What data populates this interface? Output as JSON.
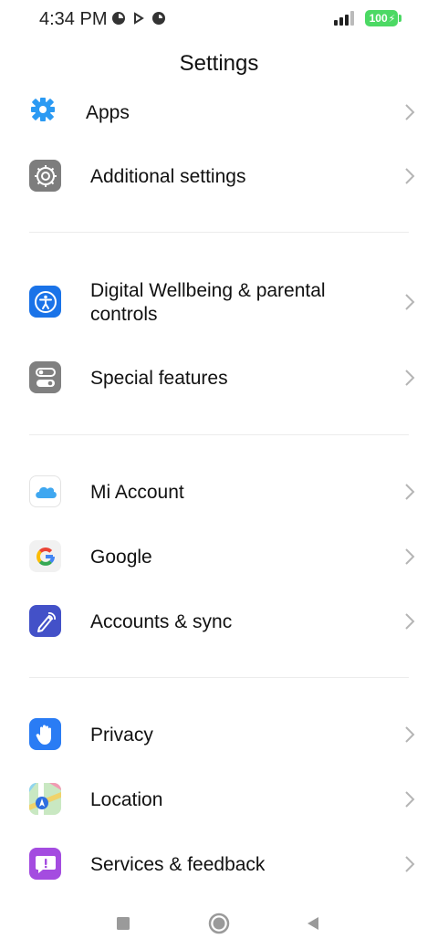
{
  "status_bar": {
    "time": "4:34 PM",
    "battery": "100"
  },
  "header": {
    "title": "Settings"
  },
  "groups": [
    {
      "items": [
        {
          "label": "Apps",
          "icon": "gear-icon",
          "color": "#2b9af3"
        },
        {
          "label": "Additional settings",
          "icon": "settings-gear-icon",
          "color": "#7d7d7d"
        }
      ]
    },
    {
      "items": [
        {
          "label": "Digital Wellbeing & parental controls",
          "icon": "accessibility-icon",
          "color": "#1a73e8"
        },
        {
          "label": "Special features",
          "icon": "toggle-icon",
          "color": "#808080"
        }
      ]
    },
    {
      "items": [
        {
          "label": "Mi Account",
          "icon": "cloud-icon",
          "color": "#3fa7f0"
        },
        {
          "label": "Google",
          "icon": "google-icon",
          "color": "#f1f1f1"
        },
        {
          "label": "Accounts & sync",
          "icon": "pen-sync-icon",
          "color": "#4351c8"
        }
      ]
    },
    {
      "items": [
        {
          "label": "Privacy",
          "icon": "hand-icon",
          "color": "#2a7cf4"
        },
        {
          "label": "Location",
          "icon": "map-icon",
          "color": "#6cc04a"
        },
        {
          "label": "Services & feedback",
          "icon": "feedback-icon",
          "color": "#a44ce0"
        }
      ]
    }
  ],
  "nav": {
    "recents": "recents-icon",
    "home": "home-icon",
    "back": "back-icon"
  }
}
